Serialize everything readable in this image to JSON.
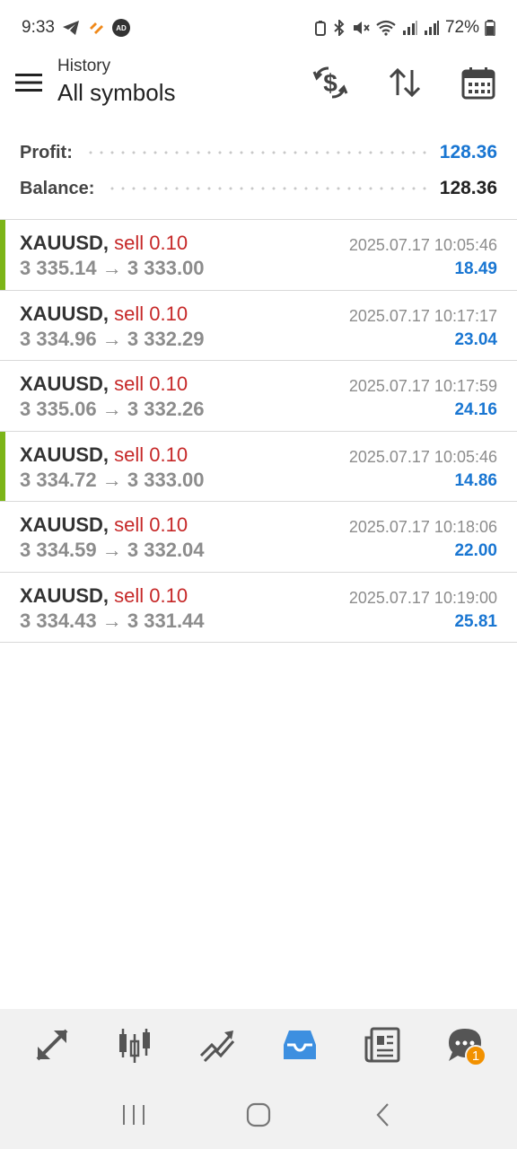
{
  "status": {
    "time": "9:33",
    "ad_badge": "AD",
    "battery": "72%",
    "icons": [
      "telegram-icon",
      "app-icon",
      "ad-icon",
      "battery-saver-icon",
      "bluetooth-icon",
      "mute-icon",
      "wifi-icon",
      "signal-icon",
      "signal-icon",
      "battery-icon"
    ]
  },
  "header": {
    "subtitle": "History",
    "title": "All symbols",
    "actions": [
      "currency-exchange-icon",
      "sort-icon",
      "calendar-icon"
    ]
  },
  "summary": {
    "profit_label": "Profit:",
    "profit_value": "128.36",
    "balance_label": "Balance:",
    "balance_value": "128.36"
  },
  "deals": [
    {
      "symbol": "XAUUSD,",
      "side": "sell 0.10",
      "open": "3 335.14",
      "arrow": "→",
      "close": "3 333.00",
      "time": "2025.07.17 10:05:46",
      "profit": "18.49",
      "marked": true
    },
    {
      "symbol": "XAUUSD,",
      "side": "sell 0.10",
      "open": "3 334.96",
      "arrow": "→",
      "close": "3 332.29",
      "time": "2025.07.17 10:17:17",
      "profit": "23.04",
      "marked": false
    },
    {
      "symbol": "XAUUSD,",
      "side": "sell 0.10",
      "open": "3 335.06",
      "arrow": "→",
      "close": "3 332.26",
      "time": "2025.07.17 10:17:59",
      "profit": "24.16",
      "marked": false
    },
    {
      "symbol": "XAUUSD,",
      "side": "sell 0.10",
      "open": "3 334.72",
      "arrow": "→",
      "close": "3 333.00",
      "time": "2025.07.17 10:05:46",
      "profit": "14.86",
      "marked": true
    },
    {
      "symbol": "XAUUSD,",
      "side": "sell 0.10",
      "open": "3 334.59",
      "arrow": "→",
      "close": "3 332.04",
      "time": "2025.07.17 10:18:06",
      "profit": "22.00",
      "marked": false
    },
    {
      "symbol": "XAUUSD,",
      "side": "sell 0.10",
      "open": "3 334.43",
      "arrow": "→",
      "close": "3 331.44",
      "time": "2025.07.17 10:19:00",
      "profit": "25.81",
      "marked": false
    }
  ],
  "bottom_nav": {
    "items": [
      "quotes-icon",
      "chart-icon",
      "trade-icon",
      "history-icon",
      "news-icon",
      "messages-icon"
    ],
    "active": "history-icon",
    "messages_badge": "1"
  },
  "system_nav": [
    "recents-icon",
    "home-icon",
    "back-icon"
  ],
  "colors": {
    "accent": "#1976d2",
    "sell": "#c62828",
    "marker": "#7cb518",
    "badge": "#f29100",
    "active_nav": "#3d8fe0"
  }
}
